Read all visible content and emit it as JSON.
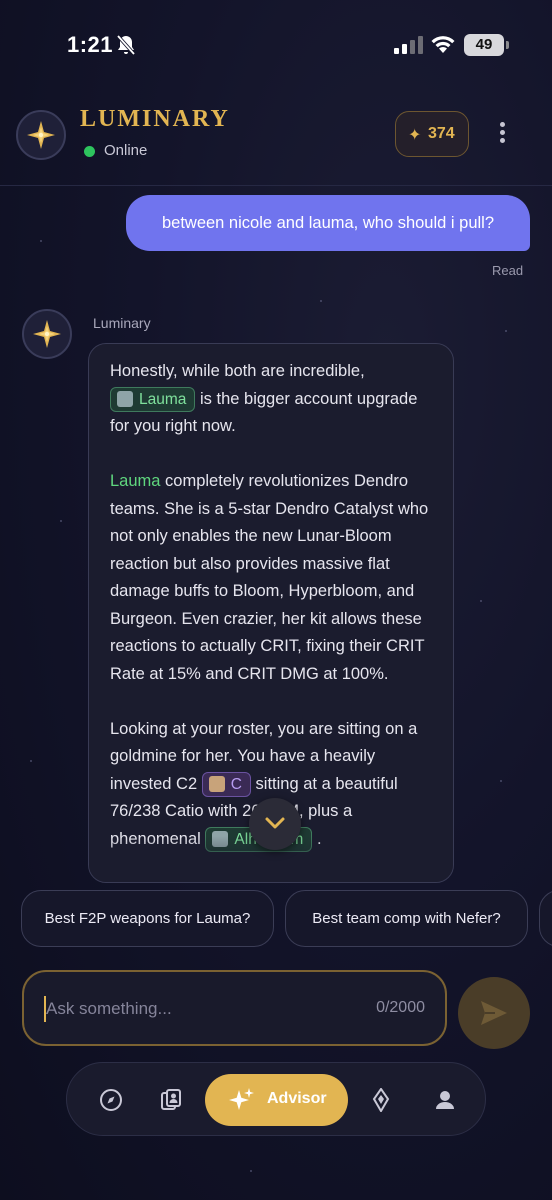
{
  "status_bar": {
    "time": "1:21",
    "battery": "49"
  },
  "header": {
    "app_name": "LUMINARY",
    "status": "Online",
    "credits": "374"
  },
  "conversation": {
    "user_message": "between nicole and lauma, who should i pull?",
    "receipt": "Read",
    "bot_name": "Luminary",
    "p1_before": "Honestly, while both are incredible,",
    "p1_chip": "Lauma",
    "p1_after": "is the bigger account upgrade for you right now.",
    "p2_highlight": "Lauma",
    "p2_rest": "completely revolutionizes Dendro teams. She is a 5-star Dendro Catalyst who not only enables the new Lunar-Bloom reaction but also provides massive flat damage buffs to Bloom, Hyperbloom, and Burgeon. Even crazier, her kit allows these reactions to actually CRIT, fixing their CRIT Rate at 15% and CRIT DMG at 100%.",
    "p3_a": "Looking at your roster, you are sitting on a goldmine for her. You have a heavily invested C2",
    "p3_chip1": "C",
    "p3_b": "sitting at a beautiful 76/238 C",
    "p3_c": "atio with 267 EM, plus a phenomenal",
    "p3_chip2": "Alhaitham",
    "p3_d": "."
  },
  "suggestions": [
    "Best F2P weapons for Lauma?",
    "Best team comp with Nefer?",
    ""
  ],
  "composer": {
    "placeholder": "Ask something...",
    "counter": "0/2000"
  },
  "nav": {
    "advisor_label": "Advisor",
    "active": "advisor"
  },
  "colors": {
    "accent_gold": "#e2b552",
    "user_bubble": "#7074ee",
    "online": "#2ec45e",
    "mention_green": "#5fd67e"
  }
}
